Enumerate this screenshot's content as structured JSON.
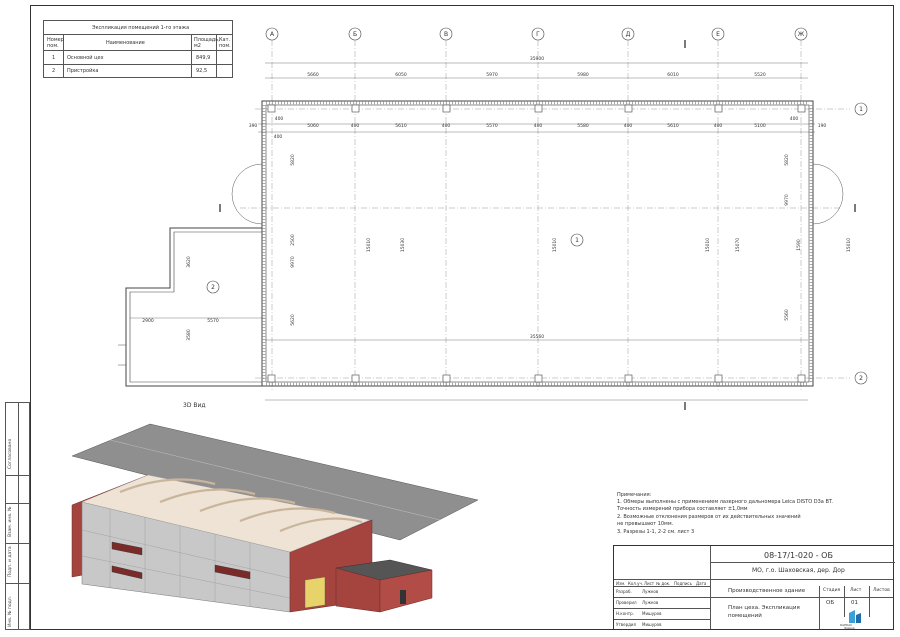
{
  "explication": {
    "title": "Экспликация помещений 1-го этажа",
    "headers": [
      "Номер пом.",
      "Наименование",
      "Площадь, м2",
      "Кат. пом."
    ],
    "rows": [
      {
        "num": "1",
        "name": "Основной цех",
        "area": "849,9",
        "cat": ""
      },
      {
        "num": "2",
        "name": "Пристройка",
        "area": "92,5",
        "cat": ""
      }
    ]
  },
  "axes": {
    "vertical": [
      "А",
      "Б",
      "В",
      "Г",
      "Д",
      "Е",
      "Ж"
    ],
    "horizontal": [
      "1",
      "2"
    ]
  },
  "dimensions": {
    "overall_top": "35900",
    "top_spans": [
      "5660",
      "6050",
      "5970",
      "5980",
      "6010",
      "5520"
    ],
    "inner_spans": [
      "5060",
      "5610",
      "5570",
      "5580",
      "5610",
      "5100"
    ],
    "small": [
      "400",
      "400",
      "400",
      "400",
      "400",
      "400",
      "400",
      "400"
    ],
    "edge_left": "390",
    "edge_right": "190",
    "overall_bottom": "35560",
    "annex_w1": "2900",
    "annex_w2": "5570",
    "annex_h": "3620",
    "annex_h2": "3580",
    "vert_left": [
      "5820",
      "2500",
      "9970",
      "5620"
    ],
    "vert_right": [
      "5820",
      "9970",
      "1590",
      "5560"
    ],
    "vert_columns": [
      "15010",
      "15030",
      "15010",
      "15010",
      "15070"
    ],
    "vert_outer_right": "15010"
  },
  "rooms": {
    "room1": "1",
    "room2": "2"
  },
  "view3d_label": "3D Вид",
  "notes": {
    "title": "Примечания:",
    "items": [
      "1.   Обмеры выполнены с применением лазерного дальномера Leica DISTO D3a BT.",
      "      Точность измерений прибора составляет ±1,0мм",
      "2.   Возможные отклонения размеров от их действительных значений",
      "      не превышают 10мм.",
      "3.   Разрезы 1-1, 2-2 см. лист 3"
    ]
  },
  "title_block": {
    "code": "08-17/1-020 - ОБ",
    "address": "МО, г.о. Шаховская, дер. Дор",
    "object": "Производственное здание",
    "sheet_title": "План цеха. Экспликация помещений",
    "col_headers": [
      "Изм.",
      "Кол.уч.",
      "Лист",
      "№ док.",
      "Подпись",
      "Дата"
    ],
    "stage_label": "Стадия",
    "sheet_label": "Лист",
    "sheets_label": "Листов",
    "stage": "ОБ",
    "sheet": "01",
    "sheets": "",
    "roles": [
      {
        "role": "Разраб.",
        "name": "Лужков"
      },
      {
        "role": "Проверил",
        "name": "Лужков"
      },
      {
        "role": "Н.контр.",
        "name": "Мишуров"
      },
      {
        "role": "Утвердил",
        "name": "Мишуров"
      }
    ],
    "logo_text": "КАРКАС",
    "logo_sub": "Фирма"
  },
  "side_stamp": [
    "Согласовано",
    "Взам. инв. №",
    "Подп. и дата",
    "Инв. № подл."
  ],
  "colors": {
    "wall": "#a5443f",
    "panel": "#c8c8c8",
    "roof": "#8a8a8a",
    "truss": "#d9c8b4",
    "door": "#e8d36a",
    "logo": "#3aa0d8"
  }
}
